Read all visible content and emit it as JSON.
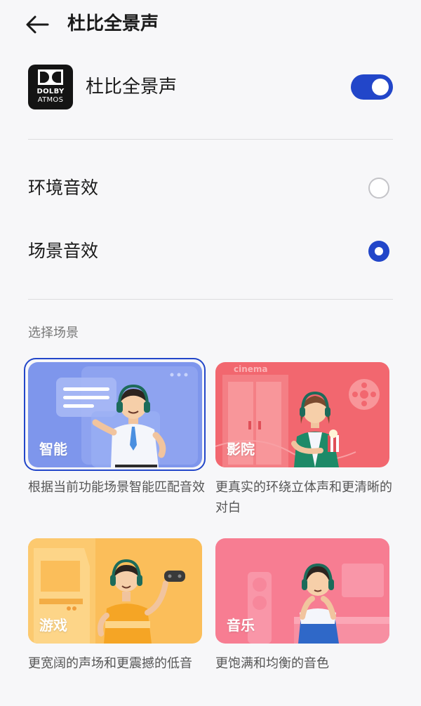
{
  "header": {
    "title": "杜比全景声",
    "back_icon": "back-arrow-icon"
  },
  "dolby": {
    "logo_line1": "DOLBY",
    "logo_line2": "ATMOS",
    "label": "杜比全景声",
    "toggle_on": true,
    "accent": "#2246c9"
  },
  "options": [
    {
      "label": "环境音效",
      "selected": false
    },
    {
      "label": "场景音效",
      "selected": true
    }
  ],
  "section_title": "选择场景",
  "scenes": [
    {
      "label": "智能",
      "description": "根据当前功能场景智能匹配音效",
      "selected": true,
      "color": "#7e96ec"
    },
    {
      "label": "影院",
      "description": "更真实的环绕立体声和更清晰的对白",
      "selected": false,
      "color": "#f2676f",
      "sign": "cinema"
    },
    {
      "label": "游戏",
      "description": "更宽阔的声场和更震撼的低音",
      "selected": false,
      "color": "#fbbe5a"
    },
    {
      "label": "音乐",
      "description": "更饱满和均衡的音色",
      "selected": false,
      "color": "#f77d92"
    }
  ]
}
